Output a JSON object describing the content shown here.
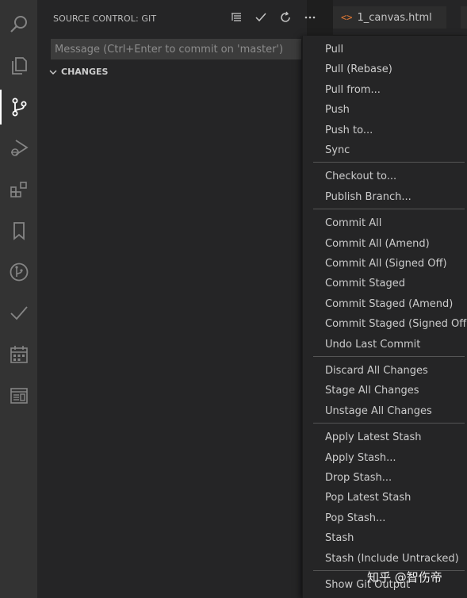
{
  "sidebar": {
    "title": "SOURCE CONTROL: GIT",
    "commit_placeholder": "Message (Ctrl+Enter to commit on 'master')",
    "changes_label": "CHANGES"
  },
  "editor_tabs": [
    {
      "label": "1_canvas.html",
      "icon": "html-icon"
    },
    {
      "label": "",
      "icon": "html-icon"
    }
  ],
  "menu": {
    "groups": [
      [
        "Pull",
        "Pull (Rebase)",
        "Pull from...",
        "Push",
        "Push to...",
        "Sync"
      ],
      [
        "Checkout to...",
        "Publish Branch..."
      ],
      [
        "Commit All",
        "Commit All (Amend)",
        "Commit All (Signed Off)",
        "Commit Staged",
        "Commit Staged (Amend)",
        "Commit Staged (Signed Off)",
        "Undo Last Commit"
      ],
      [
        "Discard All Changes",
        "Stage All Changes",
        "Unstage All Changes"
      ],
      [
        "Apply Latest Stash",
        "Apply Stash...",
        "Drop Stash...",
        "Pop Latest Stash",
        "Pop Stash...",
        "Stash",
        "Stash (Include Untracked)"
      ],
      [
        "Show Git Output"
      ]
    ]
  },
  "watermark": "知乎 @智伤帝",
  "colors": {
    "activity_bar": "#333333",
    "sidebar": "#252526",
    "editor": "#1e1e1e",
    "tab_icon": "#e37933",
    "text": "#cccccc"
  }
}
